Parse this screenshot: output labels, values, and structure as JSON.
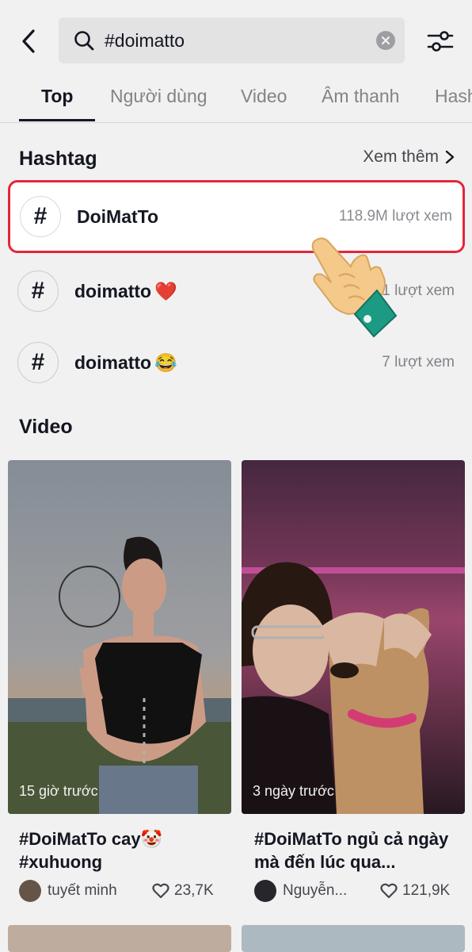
{
  "search": {
    "query": "#doimatto"
  },
  "tabs": [
    {
      "label": "Top"
    },
    {
      "label": "Người dùng"
    },
    {
      "label": "Video"
    },
    {
      "label": "Âm thanh"
    },
    {
      "label": "Hashtag"
    }
  ],
  "hashtag_section": {
    "title": "Hashtag",
    "more_label": "Xem thêm",
    "items": [
      {
        "name": "DoiMatTo",
        "emoji": "",
        "views": "118.9M lượt xem"
      },
      {
        "name": "doimatto",
        "emoji": "❤️",
        "views": "1 lượt xem"
      },
      {
        "name": "doimatto",
        "emoji": "😂",
        "views": "7 lượt xem"
      }
    ]
  },
  "video_section": {
    "title": "Video",
    "items": [
      {
        "time": "15 giờ trước",
        "caption": "#DoiMatTo cay🤡\n#xuhuong",
        "author": "tuyết minh",
        "likes": "23,7K"
      },
      {
        "time": "3 ngày trước",
        "caption": "#DoiMatTo ngủ cả ngày mà đến lúc qua...",
        "author": "Nguyễn...",
        "likes": "121,9K"
      }
    ]
  },
  "colors": {
    "highlight": "#e3263a",
    "accent_text": "#161823",
    "muted_text": "#8a8b91"
  },
  "icons": [
    "back-icon",
    "search-icon",
    "clear-icon",
    "filter-icon",
    "hash-icon",
    "chevron-right-icon",
    "heart-icon",
    "pointing-hand-icon"
  ]
}
